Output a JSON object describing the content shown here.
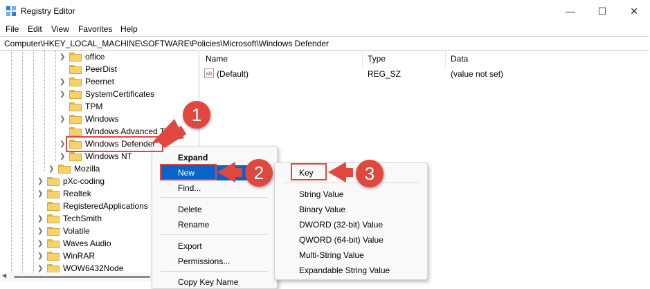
{
  "window": {
    "title": "Registry Editor",
    "buttons": {
      "minimize": "—",
      "maximize": "☐",
      "close": "✕"
    }
  },
  "menu": [
    "File",
    "Edit",
    "View",
    "Favorites",
    "Help"
  ],
  "address": "Computer\\HKEY_LOCAL_MACHINE\\SOFTWARE\\Policies\\Microsoft\\Windows Defender",
  "tree": {
    "nodes": [
      {
        "label": "office",
        "expandable": true
      },
      {
        "label": "PeerDist",
        "expandable": false
      },
      {
        "label": "Peernet",
        "expandable": true
      },
      {
        "label": "SystemCertificates",
        "expandable": true
      },
      {
        "label": "TPM",
        "expandable": false
      },
      {
        "label": "Windows",
        "expandable": true
      },
      {
        "label": "Windows Advanced Th",
        "expandable": false
      },
      {
        "label": "Windows Defender",
        "expandable": true,
        "selected": true
      },
      {
        "label": "Windows NT",
        "expandable": true
      },
      {
        "label": "Mozilla",
        "expandable": true
      },
      {
        "label": "pXc-coding",
        "expandable": true
      },
      {
        "label": "Realtek",
        "expandable": true
      },
      {
        "label": "RegisteredApplications",
        "expandable": false
      },
      {
        "label": "TechSmith",
        "expandable": true
      },
      {
        "label": "Volatile",
        "expandable": true
      },
      {
        "label": "Waves Audio",
        "expandable": true
      },
      {
        "label": "WinRAR",
        "expandable": true
      },
      {
        "label": "WOW6432Node",
        "expandable": true
      }
    ]
  },
  "list": {
    "columns": [
      "Name",
      "Type",
      "Data"
    ],
    "rows": [
      {
        "name": "(Default)",
        "type": "REG_SZ",
        "data": "(value not set)"
      }
    ]
  },
  "context_menu": {
    "items": [
      "Expand",
      "New",
      "Find...",
      "Delete",
      "Rename",
      "Export",
      "Permissions...",
      "Copy Key Name"
    ]
  },
  "submenu": {
    "items": [
      "Key",
      "String Value",
      "Binary Value",
      "DWORD (32-bit) Value",
      "QWORD (64-bit) Value",
      "Multi-String Value",
      "Expandable String Value"
    ]
  },
  "callouts": [
    "1",
    "2",
    "3"
  ],
  "colors": {
    "accent": "#0a64c8",
    "annotation": "#e0483f",
    "folder": "#f7d26b"
  },
  "icons": {
    "app": "registry-editor-icon",
    "value": "string-value-icon",
    "folder": "folder-icon"
  }
}
